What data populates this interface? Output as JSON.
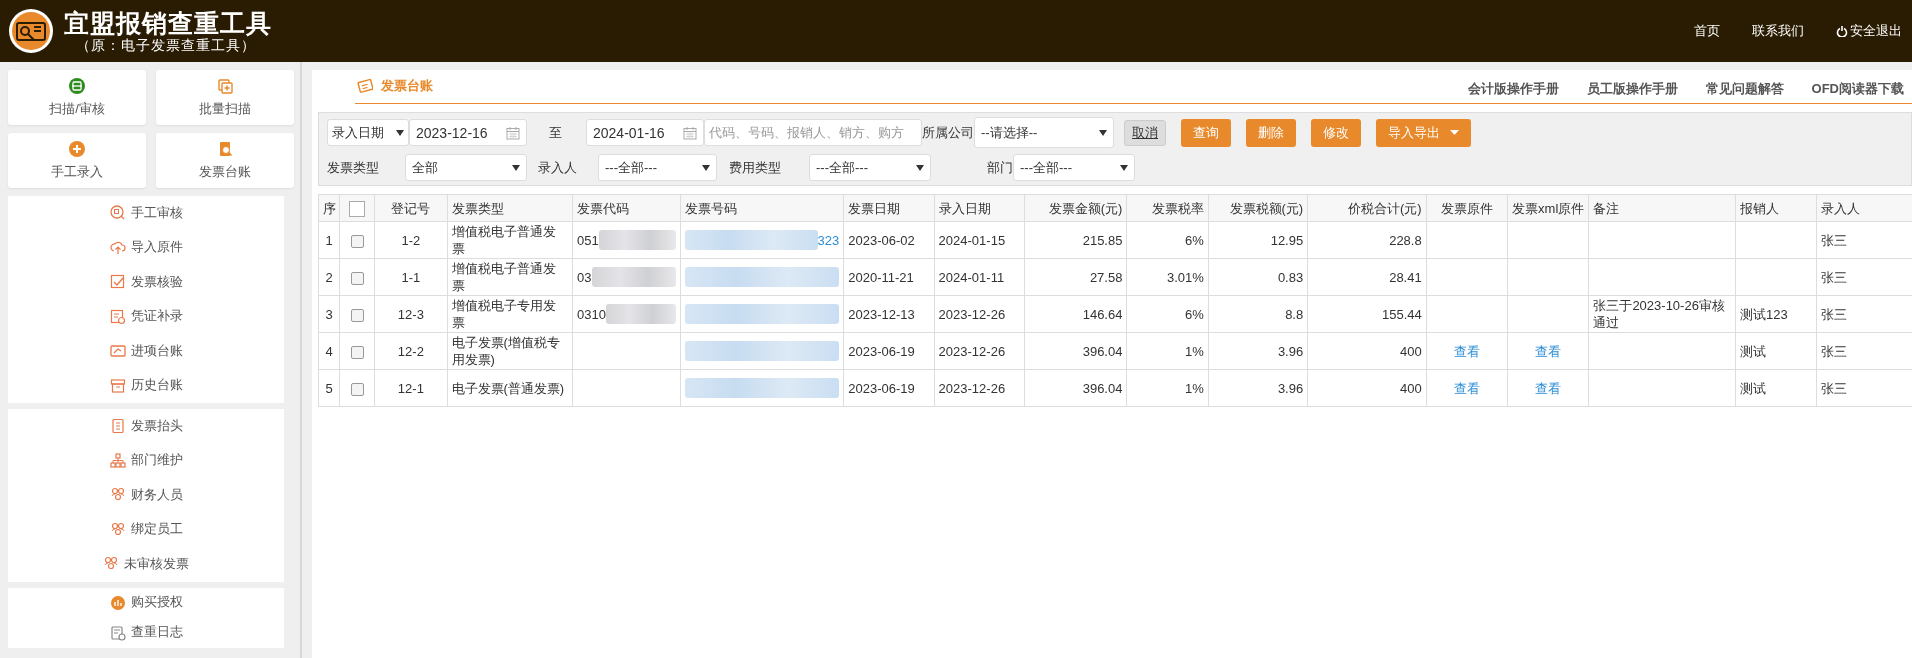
{
  "header": {
    "title": "宜盟报销查重工具",
    "subtitle": "（原：电子发票查重工具）",
    "nav": [
      "首页",
      "联系我们",
      "安全退出"
    ]
  },
  "sidebar": {
    "tiles": [
      "扫描/审核",
      "批量扫描",
      "手工录入",
      "发票台账"
    ],
    "groups": [
      [
        "手工审核",
        "导入原件",
        "发票核验",
        "凭证补录",
        "进项台账",
        "历史台账"
      ],
      [
        "发票抬头",
        "部门维护",
        "财务人员",
        "绑定员工",
        "未审核发票"
      ],
      [
        "购买授权",
        "查重日志"
      ]
    ]
  },
  "tab": {
    "label": "发票台账",
    "selected": true
  },
  "help_links": [
    "会计版操作手册",
    "员工版操作手册",
    "常见问题解答",
    "OFD阅读器下载"
  ],
  "filters": {
    "date_type": "录入日期",
    "date_from": "2023-12-16",
    "to_label": "至",
    "date_to": "2024-01-16",
    "search_placeholder": "代码、号码、报销人、销方、购方",
    "company_label": "所属公司",
    "company": "--请选择--",
    "cancel": "取消",
    "actions": [
      "查询",
      "删除",
      "修改"
    ],
    "import_export": "导入导出",
    "selects": [
      {
        "label": "发票类型",
        "value": "全部"
      },
      {
        "label": "录入人",
        "value": "---全部---"
      },
      {
        "label": "费用类型",
        "value": "---全部---"
      },
      {
        "label": "部门",
        "value": "---全部---"
      }
    ]
  },
  "table": {
    "columns": [
      "序",
      "",
      "登记号",
      "发票类型",
      "发票代码",
      "发票号码",
      "发票日期",
      "录入日期",
      "发票金额(元)",
      "发票税率",
      "发票税额(元)",
      "价税合计(元)",
      "发票原件",
      "发票xml原件",
      "备注",
      "报销人",
      "录入人"
    ],
    "select_all_checked": false,
    "rows": [
      {
        "no": "1",
        "checked": false,
        "reg": "1-2",
        "type": "增值税电子普通发票",
        "code": "051",
        "code_redacted": true,
        "number": "323",
        "number_redacted": true,
        "invoice_date": "2023-06-02",
        "entry_date": "2024-01-15",
        "amount": "215.85",
        "rate": "6%",
        "tax": "12.95",
        "total": "228.8",
        "entered_by": "张三"
      },
      {
        "no": "2",
        "checked": false,
        "reg": "1-1",
        "type": "增值税电子普通发票",
        "code": "03",
        "code_redacted": true,
        "number_redacted": true,
        "invoice_date": "2020-11-21",
        "entry_date": "2024-01-11",
        "amount": "27.58",
        "rate": "3.01%",
        "tax": "0.83",
        "total": "28.41",
        "entered_by": "张三"
      },
      {
        "no": "3",
        "checked": false,
        "reg": "12-3",
        "type": "增值税电子专用发票",
        "code": "0310",
        "code_redacted": true,
        "number_redacted": true,
        "invoice_date": "2023-12-13",
        "entry_date": "2023-12-26",
        "amount": "146.64",
        "rate": "6%",
        "tax": "8.8",
        "total": "155.44",
        "remark": "张三于2023-10-26审核通过",
        "claimant": "测试123",
        "entered_by": "张三"
      },
      {
        "no": "4",
        "checked": false,
        "reg": "12-2",
        "type": "电子发票(增值税专用发票)",
        "number_redacted": true,
        "invoice_date": "2023-06-19",
        "entry_date": "2023-12-26",
        "amount": "396.04",
        "rate": "1%",
        "tax": "3.96",
        "total": "400",
        "original": "查看",
        "xml": "查看",
        "claimant": "测试",
        "entered_by": "张三"
      },
      {
        "no": "5",
        "checked": false,
        "reg": "12-1",
        "type": "电子发票(普通发票)",
        "number_redacted": true,
        "invoice_date": "2023-06-19",
        "entry_date": "2023-12-26",
        "amount": "396.04",
        "rate": "1%",
        "tax": "3.96",
        "total": "400",
        "original": "查看",
        "xml": "查看",
        "claimant": "测试",
        "entered_by": "张三"
      }
    ]
  }
}
